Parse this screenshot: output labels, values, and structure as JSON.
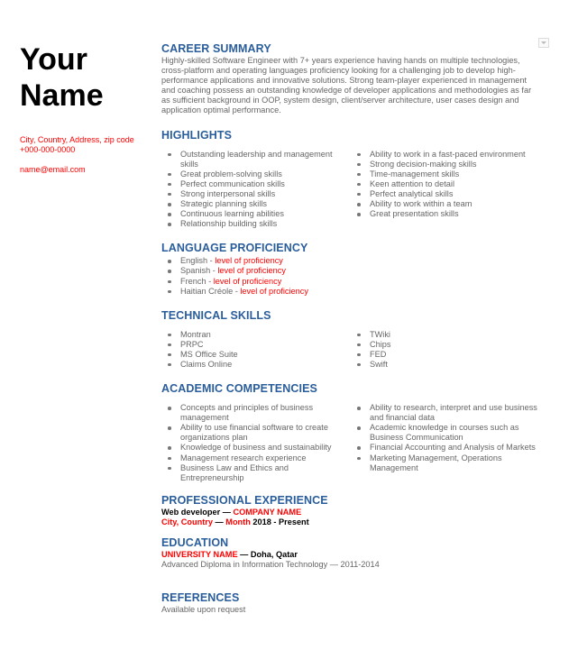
{
  "header": {
    "name_line1": "Your",
    "name_line2": "Name",
    "address": "City, Country, Address, zip code",
    "phone": "+000-000-0000",
    "email": "name@email.com"
  },
  "colors": {
    "heading": "#2a5d9b",
    "accent": "#ff0000",
    "body": "#666666"
  },
  "career_summary": {
    "title": "CAREER SUMMARY",
    "text": "Highly-skilled Software Engineer with 7+ years experience having hands on multiple technologies, cross-platform and operating languages proficiency looking for a challenging job to  develop high-performance applications and innovative solutions. Strong team-player experienced in management and coaching possess an outstanding knowledge of  developer applications and methodologies as far as sufficient background in OOP, system design, client/server architecture, user cases design and application optimal performance."
  },
  "highlights": {
    "title": "HIGHLIGHTS",
    "left": [
      "Outstanding leadership and management skills",
      "Great problem-solving skills",
      "Perfect communication skills",
      "Strong interpersonal skills",
      "Strategic planning skills",
      "Continuous learning abilities",
      "Relationship building skills"
    ],
    "right": [
      "Ability to work in a fast-paced environment",
      "Strong decision-making skills",
      "Time-management skills",
      "Keen attention to detail",
      "Perfect analytical skills",
      "Ability to work within a team",
      "Great presentation skills"
    ]
  },
  "languages": {
    "title": "LANGUAGE PROFICIENCY",
    "items": [
      {
        "language": "English - ",
        "level": "level of proficiency"
      },
      {
        "language": "Spanish - ",
        "level": "level of proficiency"
      },
      {
        "language": "French - ",
        "level": "level of proficiency"
      },
      {
        "language": "Haitian Créole - ",
        "level": "level of proficiency"
      }
    ]
  },
  "technical_skills": {
    "title": "TECHNICAL SKILLS",
    "left": [
      "Montran",
      "PRPC",
      "MS Office Suite",
      "Claims Online"
    ],
    "right": [
      "TWiki",
      "Chips",
      "FED",
      "Swift"
    ]
  },
  "academic": {
    "title": "ACADEMIC COMPETENCIES",
    "left": [
      "Concepts and principles of business management",
      "Ability to use financial software to create organizations plan",
      "Knowledge of business and sustainability",
      "Management research experience",
      "Business Law and Ethics and Entrepreneurship"
    ],
    "right": [
      "Ability to research, interpret and use business and financial data",
      "Academic knowledge in courses such as Business Communication",
      "Financial Accounting and Analysis of Markets",
      "Marketing Management, Operations Management"
    ]
  },
  "experience": {
    "title": "PROFESSIONAL EXPERIENCE",
    "role": "Web developer — ",
    "company": "COMPANY NAME",
    "location": "City, Country",
    "sep": " — ",
    "month": "Month",
    "period": " 2018 - Present"
  },
  "education": {
    "title": "EDUCATION",
    "university": "UNIVERSITY NAME",
    "location": " — Doha, Qatar",
    "degree": "Advanced Diploma in Information Technology — 2011-2014"
  },
  "references": {
    "title": "REFERENCES",
    "text": "Available upon request"
  }
}
